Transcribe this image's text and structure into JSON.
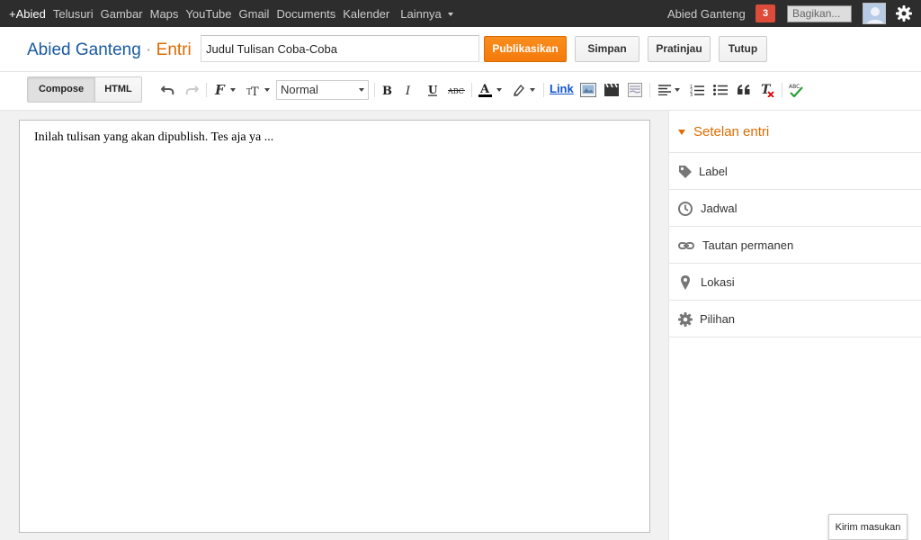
{
  "topbar": {
    "nav": [
      "+Abied",
      "Telusuri",
      "Gambar",
      "Maps",
      "YouTube",
      "Gmail",
      "Documents",
      "Kalender",
      "Lainnya"
    ],
    "user_name": "Abied Ganteng",
    "notification_count": "3",
    "share_placeholder": "Bagikan..."
  },
  "header": {
    "blog_name": "Abied Ganteng",
    "separator": "·",
    "section": "Entri",
    "post_title_value": "Judul Tulisan Coba-Coba",
    "buttons": {
      "publish": "Publikasikan",
      "save": "Simpan",
      "preview": "Pratinjau",
      "close": "Tutup"
    }
  },
  "toolbar": {
    "compose_label": "Compose",
    "html_label": "HTML",
    "format_value": "Normal",
    "link_label": "Link",
    "active_mode": "Compose"
  },
  "editor": {
    "content": "Inilah tulisan yang akan dipublish. Tes aja ya ..."
  },
  "sidebar": {
    "heading": "Setelan entri",
    "items": [
      {
        "label": "Label",
        "icon": "tag-icon"
      },
      {
        "label": "Jadwal",
        "icon": "clock-icon"
      },
      {
        "label": "Tautan permanen",
        "icon": "link-icon"
      },
      {
        "label": "Lokasi",
        "icon": "location-pin-icon"
      },
      {
        "label": "Pilihan",
        "icon": "gear-icon"
      }
    ]
  },
  "feedback_label": "Kirim masukan",
  "colors": {
    "accent_orange": "#dd6b00",
    "blog_blue": "#1a5aa1",
    "publish_button": "#f47a0b",
    "topbar_bg": "#2d2d2d",
    "notification_red": "#dd4b39"
  }
}
